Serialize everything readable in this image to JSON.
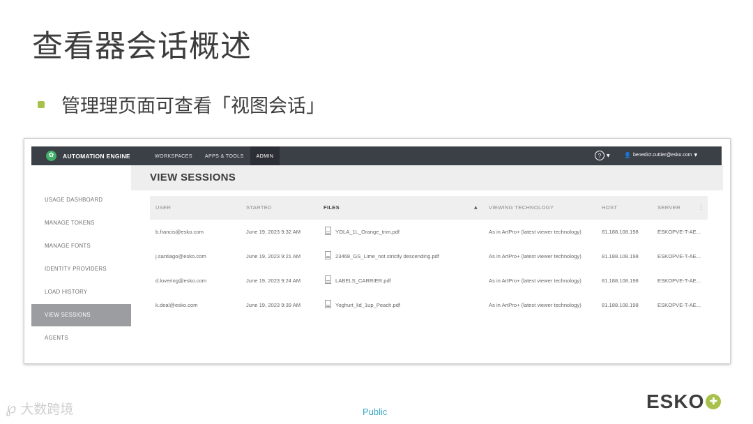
{
  "slide": {
    "title": "查看器会话概述",
    "bullet": "管理理页面可查看「视图会话」",
    "footer_label": "Public",
    "brand_logo": "ESKO",
    "watermark": "大数跨境",
    "colors": {
      "bullet": "#a7c14b",
      "footer_label": "#3fa9c8"
    }
  },
  "app": {
    "brand": "AUTOMATION ENGINE",
    "logo_icon": "gear-icon",
    "nav_tabs": [
      {
        "label": "WORKSPACES",
        "active": false
      },
      {
        "label": "APPS & TOOLS",
        "active": false
      },
      {
        "label": "ADMIN",
        "active": true
      }
    ],
    "help_icon": "?",
    "user_email": "benedict.cuttier@esko.com",
    "colors": {
      "topbar": "#3b3f46",
      "logo": "#42b06a",
      "active_sidebar": "#9b9da1"
    }
  },
  "sidebar": {
    "items": [
      {
        "label": "USAGE DASHBOARD",
        "active": false
      },
      {
        "label": "MANAGE TOKENS",
        "active": false
      },
      {
        "label": "MANAGE FONTS",
        "active": false
      },
      {
        "label": "IDENTITY PROVIDERS",
        "active": false
      },
      {
        "label": "LOAD HISTORY",
        "active": false
      },
      {
        "label": "VIEW SESSIONS",
        "active": true
      },
      {
        "label": "AGENTS",
        "active": false
      }
    ]
  },
  "main": {
    "title": "VIEW SESSIONS",
    "columns": [
      "USER",
      "STARTED",
      "FILES",
      "VIEWING TECHNOLOGY",
      "HOST",
      "SERVER"
    ],
    "sort_icon": "sort-up-icon",
    "rows": [
      {
        "user": "b.francis@esko.com",
        "started": "June 19, 2023 9:32 AM",
        "file": "YOLA_1L_Orange_trim.pdf",
        "tech": "As in ArtPro+ (latest viewer technology)",
        "host": "81.188.108.198",
        "server": "ESKOPVE-T-AE..."
      },
      {
        "user": "j.santiago@esko.com",
        "started": "June 19, 2023 9:21 AM",
        "file": "23468_GS_Lime_not strictly descending.pdf",
        "tech": "As in ArtPro+ (latest viewer technology)",
        "host": "81.188.108.198",
        "server": "ESKOPVE-T-AE..."
      },
      {
        "user": "d.lovering@esko.com",
        "started": "June 19, 2023 9:24 AM",
        "file": "LABELS_CARRIER.pdf",
        "tech": "As in ArtPro+ (latest viewer technology)",
        "host": "81.188.108.198",
        "server": "ESKOPVE-T-AE..."
      },
      {
        "user": "k.deal@esko.com",
        "started": "June 19, 2023 9:39 AM",
        "file": "Yoghurt_lid_1up_Peach.pdf",
        "tech": "As in ArtPro+ (latest viewer technology)",
        "host": "81.188.108.198",
        "server": "ESKOPVE-T-AE..."
      }
    ]
  }
}
